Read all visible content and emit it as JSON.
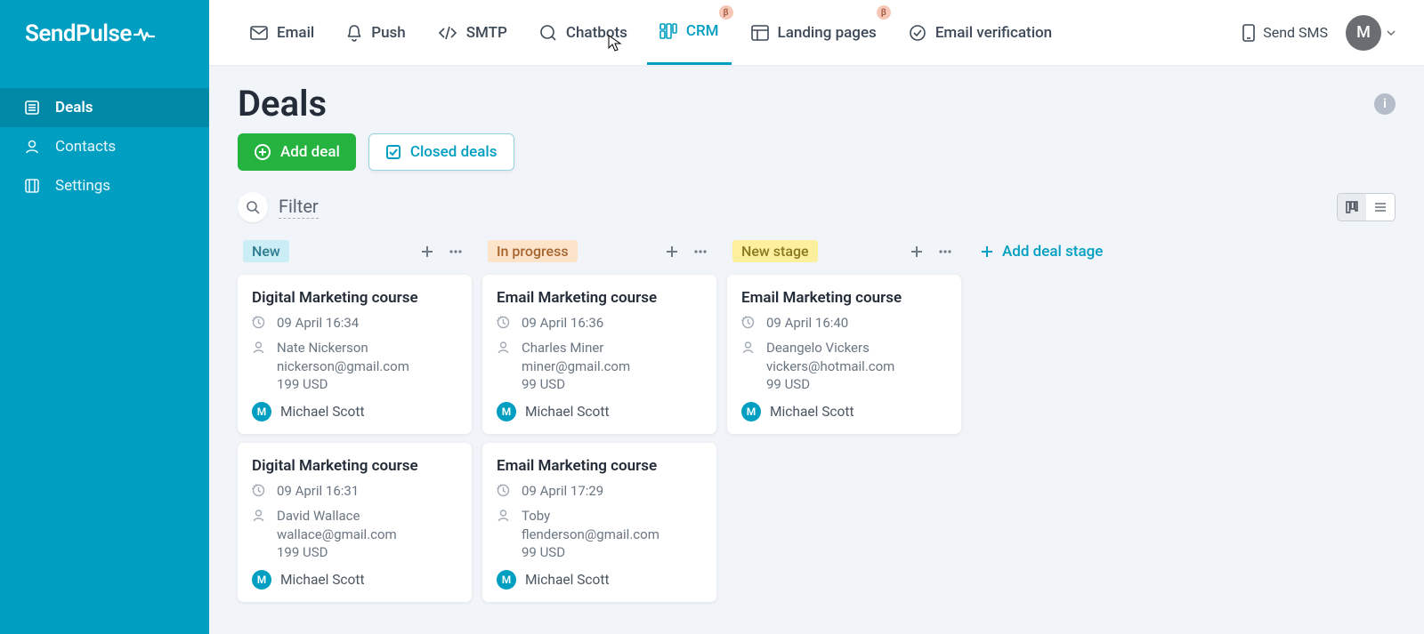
{
  "brand": "SendPulse",
  "sidebar": {
    "items": [
      {
        "label": "Deals",
        "icon": "list-icon",
        "active": true
      },
      {
        "label": "Contacts",
        "icon": "users-icon",
        "active": false
      },
      {
        "label": "Settings",
        "icon": "settings-icon",
        "active": false
      }
    ]
  },
  "topnav": {
    "items": [
      {
        "label": "Email",
        "icon": "mail-icon",
        "beta": false,
        "active": false
      },
      {
        "label": "Push",
        "icon": "bell-icon",
        "beta": false,
        "active": false
      },
      {
        "label": "SMTP",
        "icon": "code-icon",
        "beta": false,
        "active": false
      },
      {
        "label": "Chatbots",
        "icon": "chat-icon",
        "beta": false,
        "active": false
      },
      {
        "label": "CRM",
        "icon": "board-icon",
        "beta": true,
        "active": true
      },
      {
        "label": "Landing pages",
        "icon": "layout-icon",
        "beta": true,
        "active": false
      },
      {
        "label": "Email verification",
        "icon": "check-circle-icon",
        "beta": false,
        "active": false
      }
    ],
    "send_sms": "Send SMS",
    "avatar_initial": "M",
    "beta_label": "β"
  },
  "page": {
    "title": "Deals",
    "add_deal": "Add deal",
    "closed_deals": "Closed deals",
    "filter_label": "Filter",
    "add_stage": "Add deal stage",
    "info_label": "i"
  },
  "stages": [
    {
      "name": "New",
      "class": "sl-new",
      "cards": [
        {
          "title": "Digital Marketing course",
          "time": "09 April 16:34",
          "contact": "Nate Nickerson",
          "email": "nickerson@gmail.com",
          "price": "199 USD",
          "owner": "Michael Scott",
          "owner_initial": "M"
        },
        {
          "title": "Digital Marketing course",
          "time": "09 April 16:31",
          "contact": "David Wallace",
          "email": "wallace@gmail.com",
          "price": "199 USD",
          "owner": "Michael Scott",
          "owner_initial": "M"
        }
      ]
    },
    {
      "name": "In progress",
      "class": "sl-prog",
      "cards": [
        {
          "title": "Email Marketing course",
          "time": "09 April 16:36",
          "contact": "Charles Miner",
          "email": "miner@gmail.com",
          "price": "99 USD",
          "owner": "Michael Scott",
          "owner_initial": "M"
        },
        {
          "title": "Email Marketing course",
          "time": "09 April 17:29",
          "contact": "Toby",
          "email": "flenderson@gmail.com",
          "price": "99 USD",
          "owner": "Michael Scott",
          "owner_initial": "M"
        }
      ]
    },
    {
      "name": "New stage",
      "class": "sl-newstage",
      "cards": [
        {
          "title": "Email Marketing course",
          "time": "09 April 16:40",
          "contact": "Deangelo Vickers",
          "email": "vickers@hotmail.com",
          "price": "99 USD",
          "owner": "Michael Scott",
          "owner_initial": "M"
        }
      ]
    }
  ]
}
